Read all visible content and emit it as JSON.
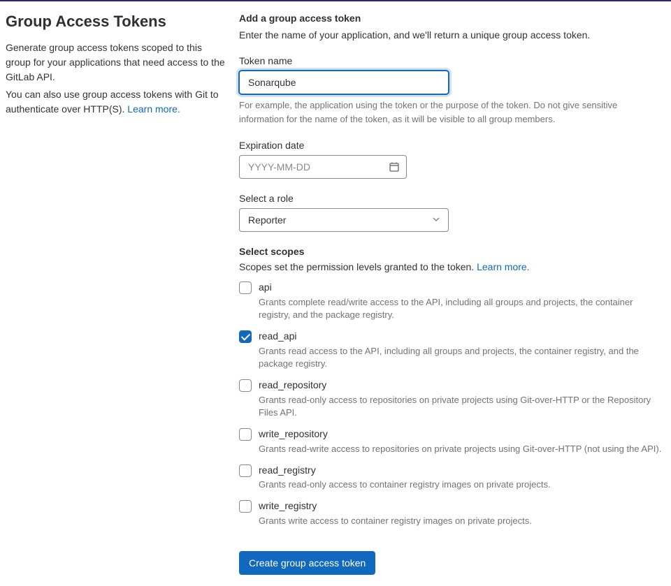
{
  "left": {
    "title": "Group Access Tokens",
    "intro1": "Generate group access tokens scoped to this group for your applications that need access to the GitLab API.",
    "intro2_pre": "You can also use group access tokens with Git to authenticate over HTTP(S). ",
    "learn_more": "Learn more."
  },
  "form": {
    "add_title": "Add a group access token",
    "add_desc": "Enter the name of your application, and we'll return a unique group access token.",
    "token_name_label": "Token name",
    "token_name_value": "Sonarqube",
    "token_name_help": "For example, the application using the token or the purpose of the token. Do not give sensitive information for the name of the token, as it will be visible to all group members.",
    "expiration_label": "Expiration date",
    "expiration_placeholder": "YYYY-MM-DD",
    "expiration_value": "",
    "role_label": "Select a role",
    "role_value": "Reporter",
    "scopes_title": "Select scopes",
    "scopes_desc_pre": "Scopes set the permission levels granted to the token. ",
    "scopes_learn_more": "Learn more.",
    "scopes": [
      {
        "key": "api",
        "label": "api",
        "checked": false,
        "desc": "Grants complete read/write access to the API, including all groups and projects, the container registry, and the package registry."
      },
      {
        "key": "read_api",
        "label": "read_api",
        "checked": true,
        "desc": "Grants read access to the API, including all groups and projects, the container registry, and the package registry."
      },
      {
        "key": "read_repository",
        "label": "read_repository",
        "checked": false,
        "desc": "Grants read-only access to repositories on private projects using Git-over-HTTP or the Repository Files API."
      },
      {
        "key": "write_repository",
        "label": "write_repository",
        "checked": false,
        "desc": "Grants read-write access to repositories on private projects using Git-over-HTTP (not using the API)."
      },
      {
        "key": "read_registry",
        "label": "read_registry",
        "checked": false,
        "desc": "Grants read-only access to container registry images on private projects."
      },
      {
        "key": "write_registry",
        "label": "write_registry",
        "checked": false,
        "desc": "Grants write access to container registry images on private projects."
      }
    ],
    "submit_label": "Create group access token"
  }
}
